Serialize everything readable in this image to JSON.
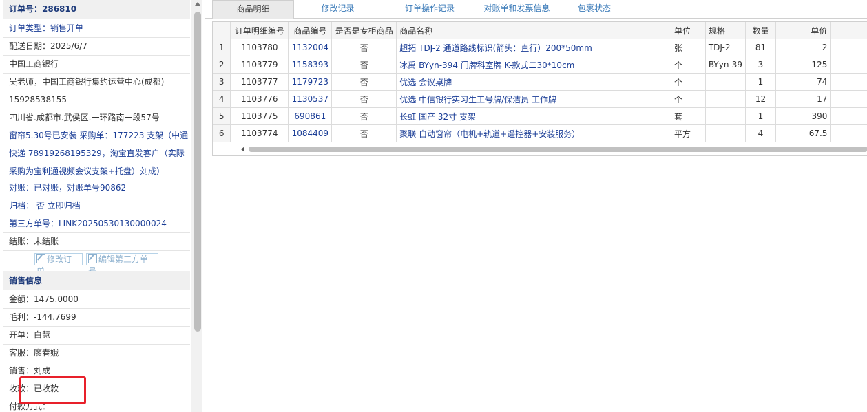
{
  "order_info": {
    "title": "订单号：286810",
    "order_type": "订单类型：销售开单",
    "delivery_date": "配送日期：2025/6/7",
    "company": "中国工商银行",
    "contact": "吴老师，中国工商银行集约运营中心(成都)",
    "phone": "15928538155",
    "address": "四川省.成都市.武侯区.一环路南一段57号",
    "note": "窗帘5.30号已安装 采购单：177223 支架（中通快递 78919268195329，淘宝直发客户（实际采购为宝利通视频会议支架+托盘）刘成）",
    "reconcile": "对账：已对账，对账单号90862",
    "archive": "归档： 否 立即归档",
    "third_party_no": "第三方单号：LINK20250530130000024",
    "settlement": "结账：未结账",
    "edit_order_button": "修改订单",
    "edit_third_party_button": "编辑第三方单号"
  },
  "sales_info": {
    "title": "销售信息",
    "amount": "金额：1475.0000",
    "gross_profit": "毛利：-144.7699",
    "issuer": "开单：白慧",
    "customer_service": "客服：廖春娥",
    "sales": "销售：刘成",
    "payment_status": "收款：已收款",
    "payment_method": "付款方式："
  },
  "tabs": [
    {
      "label": "商品明细",
      "active": true
    },
    {
      "label": "修改记录",
      "active": false
    },
    {
      "label": "订单操作记录",
      "active": false
    },
    {
      "label": "对账单和发票信息",
      "active": false
    },
    {
      "label": "包裹状态",
      "active": false
    }
  ],
  "table": {
    "columns": [
      "订单明细编号",
      "商品编号",
      "是否是专柜商品",
      "商品名称",
      "单位",
      "规格",
      "数量",
      "单价"
    ],
    "rows": [
      {
        "idx": "1",
        "detail_no": "1103780",
        "sku": "1132004",
        "counter": "否",
        "name": "超拓 TDJ-2 通道路线标识(箭头：直行）200*50mm",
        "unit": "张",
        "spec": "TDJ-2",
        "qty": "81",
        "price": "2"
      },
      {
        "idx": "2",
        "detail_no": "1103779",
        "sku": "1158393",
        "counter": "否",
        "name": "冰禹 BYyn-394 门牌科室牌 K-款式二30*10cm",
        "unit": "个",
        "spec": "BYyn-39",
        "qty": "3",
        "price": "125"
      },
      {
        "idx": "3",
        "detail_no": "1103777",
        "sku": "1179723",
        "counter": "否",
        "name": "优选 会议桌牌",
        "unit": "个",
        "spec": "",
        "qty": "1",
        "price": "74"
      },
      {
        "idx": "4",
        "detail_no": "1103776",
        "sku": "1130537",
        "counter": "否",
        "name": "优选 中信银行实习生工号牌/保洁员 工作牌",
        "unit": "个",
        "spec": "",
        "qty": "12",
        "price": "17"
      },
      {
        "idx": "5",
        "detail_no": "1103775",
        "sku": "690861",
        "counter": "否",
        "name": "长虹 国产 32寸 支架",
        "unit": "套",
        "spec": "",
        "qty": "1",
        "price": "390"
      },
      {
        "idx": "6",
        "detail_no": "1103774",
        "sku": "1084409",
        "counter": "否",
        "name": "聚联 自动窗帘（电机+轨道+遥控器+安装服务）",
        "unit": "平方",
        "spec": "",
        "qty": "4",
        "price": "67.5"
      }
    ]
  }
}
